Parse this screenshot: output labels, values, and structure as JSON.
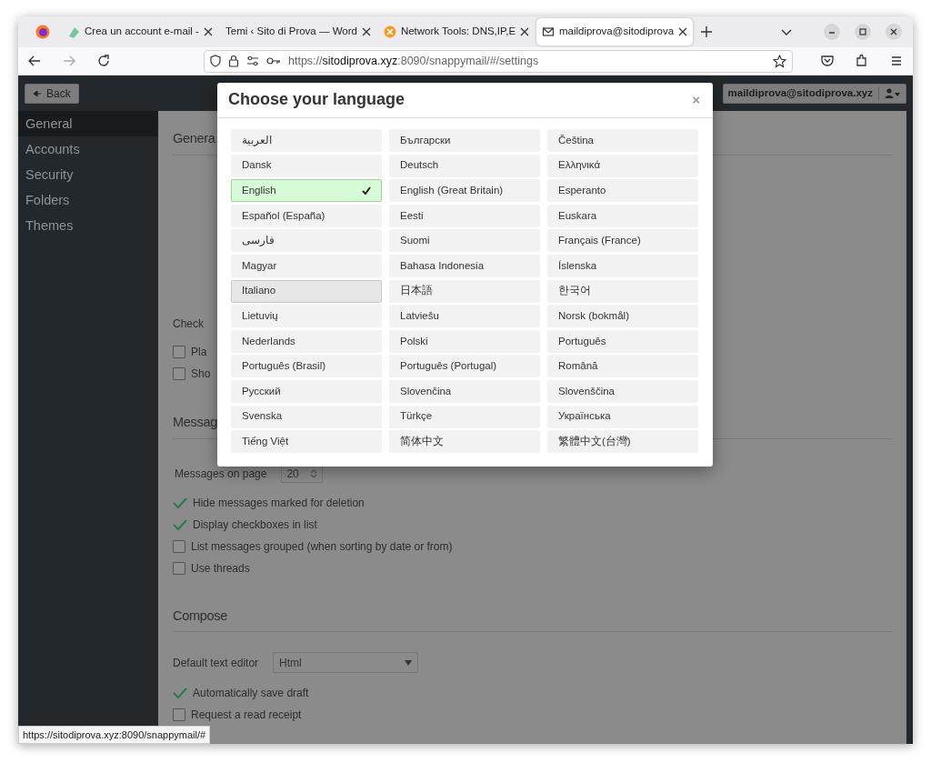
{
  "browser": {
    "tabs": [
      {
        "title": "Crea un account e-mail -",
        "selected": false
      },
      {
        "title": "Temi ‹ Sito di Prova — Word",
        "selected": false
      },
      {
        "title": "Network Tools: DNS,IP,E",
        "selected": false
      },
      {
        "title": "maildiprova@sitodiprova",
        "selected": true
      }
    ],
    "url": {
      "scheme": "https://",
      "host": "sitodiprova.xyz",
      "path": ":8090/snappymail/#/settings"
    },
    "status_link": "https://sitodiprova.xyz:8090/snappymail/#"
  },
  "app": {
    "back_button": "Back",
    "account": "maildiprova@sitodiprova.xyz",
    "sidebar": [
      {
        "label": "General",
        "selected": true
      },
      {
        "label": "Accounts",
        "selected": false
      },
      {
        "label": "Security",
        "selected": false
      },
      {
        "label": "Folders",
        "selected": false
      },
      {
        "label": "Themes",
        "selected": false
      }
    ],
    "general": {
      "heading": "Genera",
      "check_label": "Check",
      "options": [
        {
          "label": "Pla",
          "checked": false
        },
        {
          "label": "Sho",
          "checked": false
        }
      ]
    },
    "messages": {
      "heading": "Messag",
      "page_label": "Messages on page",
      "page_value": "20",
      "options": [
        {
          "label": "Hide messages marked for deletion",
          "checked": true
        },
        {
          "label": "Display checkboxes in list",
          "checked": true
        },
        {
          "label": "List messages grouped (when sorting by date or from)",
          "checked": false
        },
        {
          "label": "Use threads",
          "checked": false
        }
      ]
    },
    "compose": {
      "heading": "Compose",
      "editor_label": "Default text editor",
      "editor_value": "Html",
      "options": [
        {
          "label": "Automatically save draft",
          "checked": true
        },
        {
          "label": "Request a read receipt",
          "checked": false
        }
      ]
    }
  },
  "modal": {
    "title": "Choose your language",
    "close": "×",
    "languages": [
      {
        "label": "العربية",
        "selected": false,
        "highlighted": false
      },
      {
        "label": "Български",
        "selected": false,
        "highlighted": false
      },
      {
        "label": "Čeština",
        "selected": false,
        "highlighted": false
      },
      {
        "label": "Dansk",
        "selected": false,
        "highlighted": false
      },
      {
        "label": "Deutsch",
        "selected": false,
        "highlighted": false
      },
      {
        "label": "Ελληνικά",
        "selected": false,
        "highlighted": false
      },
      {
        "label": "English",
        "selected": true,
        "highlighted": false
      },
      {
        "label": "English (Great Britain)",
        "selected": false,
        "highlighted": false
      },
      {
        "label": "Esperanto",
        "selected": false,
        "highlighted": false
      },
      {
        "label": "Español (España)",
        "selected": false,
        "highlighted": false
      },
      {
        "label": "Eesti",
        "selected": false,
        "highlighted": false
      },
      {
        "label": "Euskara",
        "selected": false,
        "highlighted": false
      },
      {
        "label": "فارسی",
        "selected": false,
        "highlighted": false
      },
      {
        "label": "Suomi",
        "selected": false,
        "highlighted": false
      },
      {
        "label": "Français (France)",
        "selected": false,
        "highlighted": false
      },
      {
        "label": "Magyar",
        "selected": false,
        "highlighted": false
      },
      {
        "label": "Bahasa Indonesia",
        "selected": false,
        "highlighted": false
      },
      {
        "label": "Íslenska",
        "selected": false,
        "highlighted": false
      },
      {
        "label": "Italiano",
        "selected": false,
        "highlighted": true
      },
      {
        "label": "日本語",
        "selected": false,
        "highlighted": false
      },
      {
        "label": "한국어",
        "selected": false,
        "highlighted": false
      },
      {
        "label": "Lietuvių",
        "selected": false,
        "highlighted": false
      },
      {
        "label": "Latviešu",
        "selected": false,
        "highlighted": false
      },
      {
        "label": "Norsk (bokmål)",
        "selected": false,
        "highlighted": false
      },
      {
        "label": "Nederlands",
        "selected": false,
        "highlighted": false
      },
      {
        "label": "Polski",
        "selected": false,
        "highlighted": false
      },
      {
        "label": "Português",
        "selected": false,
        "highlighted": false
      },
      {
        "label": "Português (Brasil)",
        "selected": false,
        "highlighted": false
      },
      {
        "label": "Português (Portugal)",
        "selected": false,
        "highlighted": false
      },
      {
        "label": "Română",
        "selected": false,
        "highlighted": false
      },
      {
        "label": "Русский",
        "selected": false,
        "highlighted": false
      },
      {
        "label": "Slovenčina",
        "selected": false,
        "highlighted": false
      },
      {
        "label": "Slovenščina",
        "selected": false,
        "highlighted": false
      },
      {
        "label": "Svenska",
        "selected": false,
        "highlighted": false
      },
      {
        "label": "Türkçe",
        "selected": false,
        "highlighted": false
      },
      {
        "label": "Українська",
        "selected": false,
        "highlighted": false
      },
      {
        "label": "Tiếng Việt",
        "selected": false,
        "highlighted": false
      },
      {
        "label": "简体中文",
        "selected": false,
        "highlighted": false
      },
      {
        "label": "繁體中文(台灣)",
        "selected": false,
        "highlighted": false
      }
    ]
  }
}
